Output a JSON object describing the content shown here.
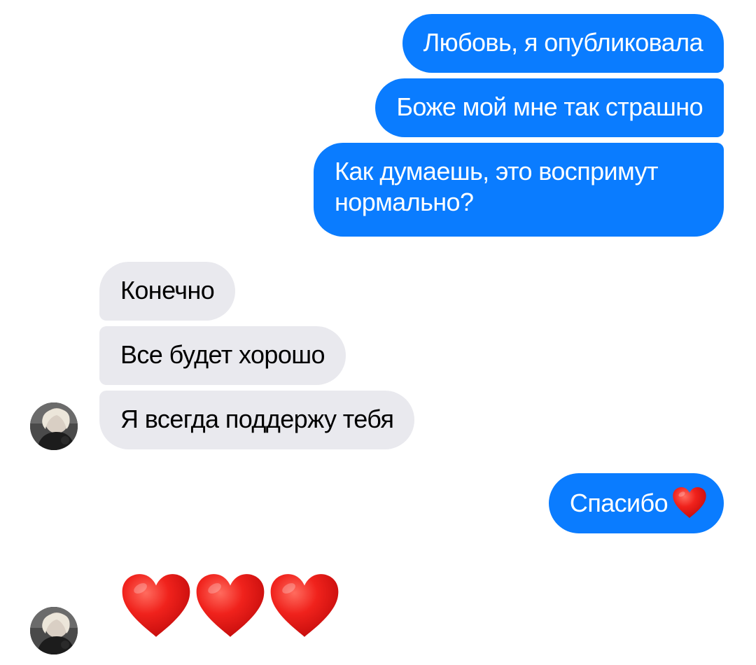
{
  "messages": {
    "outgoing_1": "Любовь, я опубликовала",
    "outgoing_2": "Боже мой мне так страшно",
    "outgoing_3": "Как думаешь, это воспримут нормально?",
    "incoming_1": "Конечно",
    "incoming_2": "Все будет хорошо",
    "incoming_3": "Я всегда поддержу тебя",
    "outgoing_4": "Спасибо"
  },
  "reaction_message": {
    "emoji": "heart-emoji",
    "count": 3
  },
  "icons": {
    "inline_heart": "heart-emoji",
    "avatar": "contact-avatar"
  },
  "colors": {
    "outgoing_bubble": "#0a7cff",
    "incoming_bubble": "#e9e9ee",
    "heart": "#e8171b"
  }
}
